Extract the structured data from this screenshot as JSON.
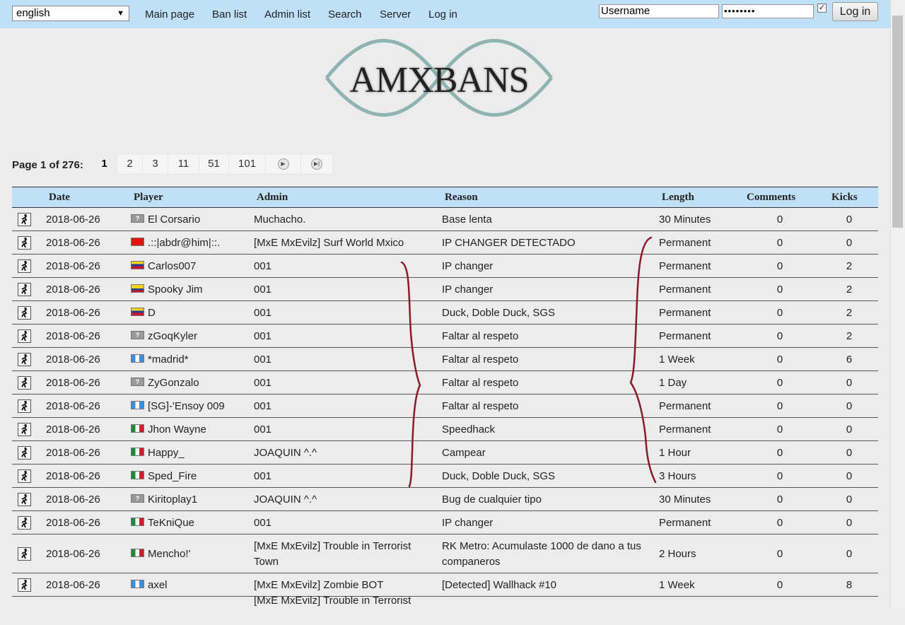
{
  "header": {
    "language": "english",
    "nav": [
      "Main page",
      "Ban list",
      "Admin list",
      "Search",
      "Server",
      "Log in"
    ],
    "username_placeholder": "Username",
    "password_mask": "••••••••",
    "remember_checked": "✓",
    "login_button": "Log in"
  },
  "logo_text": "AMXBANS",
  "pagination": {
    "label": "Page 1 of 276:",
    "pages": [
      "1",
      "2",
      "3",
      "11",
      "51",
      "101"
    ],
    "current": "1",
    "next_icon": "next-page-icon",
    "last_icon": "last-page-icon"
  },
  "table": {
    "columns": [
      "Date",
      "Player",
      "Admin",
      "Reason",
      "Length",
      "Comments",
      "Kicks"
    ],
    "rows": [
      {
        "date": "2018-06-26",
        "flag": "unknown",
        "player": "El Corsario",
        "admin": "Muchacho.",
        "reason": "Base lenta",
        "length": "30 Minutes",
        "comments": "0",
        "kicks": "0"
      },
      {
        "date": "2018-06-26",
        "flag": "cn",
        "player": ".::|abdr@him|::.",
        "admin": "[MxE MxEvilz] Surf World Mxico",
        "reason": "IP CHANGER DETECTADO",
        "length": "Permanent",
        "comments": "0",
        "kicks": "0"
      },
      {
        "date": "2018-06-26",
        "flag": "ve",
        "player": "Carlos007",
        "admin": "001",
        "reason": "IP changer",
        "length": "Permanent",
        "comments": "0",
        "kicks": "2"
      },
      {
        "date": "2018-06-26",
        "flag": "co",
        "player": "Spooky Jim",
        "admin": "001",
        "reason": "IP changer",
        "length": "Permanent",
        "comments": "0",
        "kicks": "2"
      },
      {
        "date": "2018-06-26",
        "flag": "ve",
        "player": "D",
        "admin": "001",
        "reason": "Duck, Doble Duck, SGS",
        "length": "Permanent",
        "comments": "0",
        "kicks": "2"
      },
      {
        "date": "2018-06-26",
        "flag": "unknown",
        "player": "zGoqKyler",
        "admin": "001",
        "reason": "Faltar al respeto",
        "length": "Permanent",
        "comments": "0",
        "kicks": "2"
      },
      {
        "date": "2018-06-26",
        "flag": "gt",
        "player": "*madrid*",
        "admin": "001",
        "reason": "Faltar al respeto",
        "length": "1 Week",
        "comments": "0",
        "kicks": "6"
      },
      {
        "date": "2018-06-26",
        "flag": "unknown",
        "player": "ZyGonzalo",
        "admin": "001",
        "reason": "Faltar al respeto",
        "length": "1 Day",
        "comments": "0",
        "kicks": "0"
      },
      {
        "date": "2018-06-26",
        "flag": "gt",
        "player": "[SG]-'Ensoy 009",
        "admin": "001",
        "reason": "Faltar al respeto",
        "length": "Permanent",
        "comments": "0",
        "kicks": "0"
      },
      {
        "date": "2018-06-26",
        "flag": "mx",
        "player": "Jhon Wayne",
        "admin": "001",
        "reason": "Speedhack",
        "length": "Permanent",
        "comments": "0",
        "kicks": "0"
      },
      {
        "date": "2018-06-26",
        "flag": "mx",
        "player": "Happy_",
        "admin": "JOAQUIN ^.^",
        "reason": "Campear",
        "length": "1 Hour",
        "comments": "0",
        "kicks": "0"
      },
      {
        "date": "2018-06-26",
        "flag": "mx",
        "player": "Sped_Fire",
        "admin": "001",
        "reason": "Duck, Doble Duck, SGS",
        "length": "3 Hours",
        "comments": "0",
        "kicks": "0"
      },
      {
        "date": "2018-06-26",
        "flag": "unknown",
        "player": "Kiritoplay1",
        "admin": "JOAQUIN ^.^",
        "reason": "Bug de cualquier tipo",
        "length": "30 Minutes",
        "comments": "0",
        "kicks": "0"
      },
      {
        "date": "2018-06-26",
        "flag": "mx",
        "player": "TeKniQue",
        "admin": "001",
        "reason": "IP changer",
        "length": "Permanent",
        "comments": "0",
        "kicks": "0"
      },
      {
        "date": "2018-06-26",
        "flag": "mx",
        "player": "Mencho!'",
        "admin": "[MxE MxEvilz] Trouble in Terrorist Town",
        "reason": "RK Metro: Acumulaste 1000 de dano a tus companeros",
        "length": "2 Hours",
        "comments": "0",
        "kicks": "0"
      },
      {
        "date": "2018-06-26",
        "flag": "gt",
        "player": "axel",
        "admin": "[MxE MxEvilz] Zombie BOT",
        "reason": "[Detected] Wallhack #10",
        "length": "1 Week",
        "comments": "0",
        "kicks": "8"
      },
      {
        "date": "",
        "flag": "",
        "player": "",
        "admin": "[MxE MxEvilz] Trouble in Terrorist",
        "reason": "",
        "length": "",
        "comments": "",
        "kicks": ""
      }
    ]
  },
  "colors": {
    "header_bg": "#bfe0f7",
    "page_bg": "#ececec",
    "annotation": "#8b1a2a"
  }
}
